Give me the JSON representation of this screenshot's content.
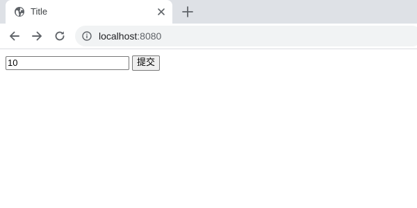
{
  "tab": {
    "title": "Title",
    "favicon": "globe-icon",
    "close_icon": "close-icon"
  },
  "new_tab_icon": "plus-icon",
  "toolbar": {
    "back_icon": "arrow-left-icon",
    "forward_icon": "arrow-right-icon",
    "reload_icon": "reload-icon",
    "info_icon": "info-icon",
    "url_host": "localhost",
    "url_port": ":8080"
  },
  "form": {
    "input_value": "10",
    "submit_label": "提交"
  },
  "colors": {
    "tabstrip_bg": "#dee1e6",
    "omnibox_bg": "#f1f3f4",
    "icon": "#5f6368"
  }
}
